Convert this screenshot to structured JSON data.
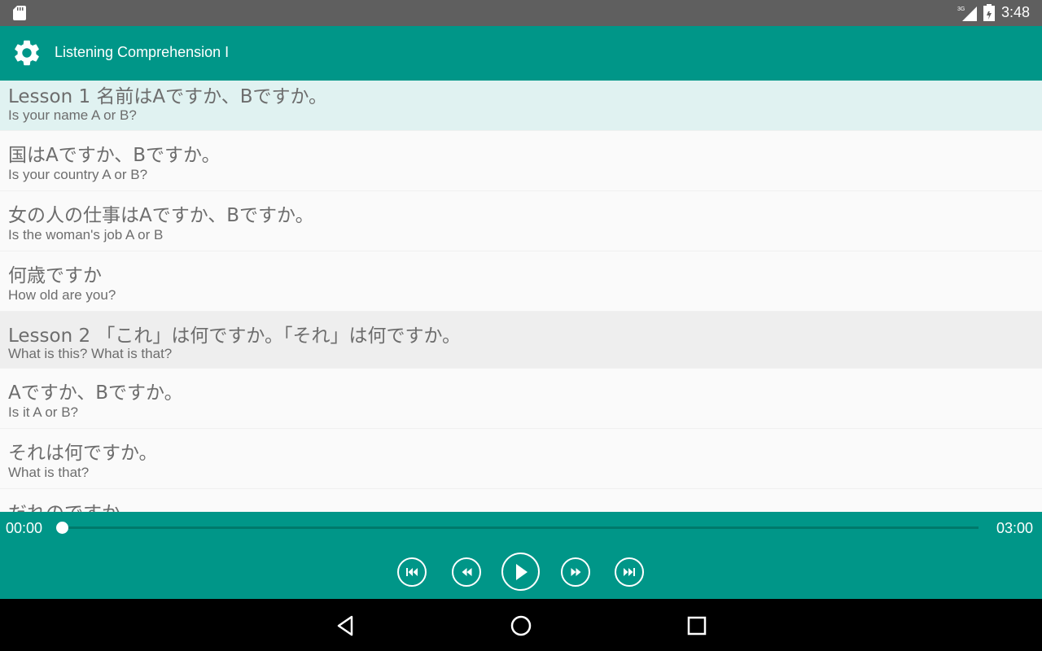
{
  "status_bar": {
    "time": "3:48",
    "network": "3G"
  },
  "app_bar": {
    "title": "Listening Comprehension I",
    "settings_icon": "gear-icon"
  },
  "lessons": [
    {
      "jp": "Lesson 1 名前はAですか、Bですか。",
      "en": "Is your name A or B?",
      "kind": "header-selected"
    },
    {
      "jp": "国はAですか、Bですか。",
      "en": "Is your country A or B?",
      "kind": "item"
    },
    {
      "jp": "女の人の仕事はAですか、Bですか。",
      "en": "Is the woman's job A or B",
      "kind": "item"
    },
    {
      "jp": "何歳ですか",
      "en": "How old are you?",
      "kind": "item"
    },
    {
      "jp": "Lesson 2 「これ」は何ですか。「それ」は何ですか。",
      "en": "What is this? What is that?",
      "kind": "header"
    },
    {
      "jp": "Aですか、Bですか。",
      "en": "Is it A or B?",
      "kind": "item"
    },
    {
      "jp": "それは何ですか。",
      "en": "What is that?",
      "kind": "item"
    },
    {
      "jp": "だれのですか。",
      "en": "",
      "kind": "item"
    }
  ],
  "player": {
    "current_time": "00:00",
    "total_time": "03:00",
    "progress": 0,
    "controls": [
      "skip-previous-icon",
      "rewind-icon",
      "play-icon",
      "fast-forward-icon",
      "skip-next-icon"
    ]
  },
  "colors": {
    "primary": "#009688",
    "selected_row": "#e0f2f1",
    "header_row": "#eeeeee",
    "status_bar": "#5f5f5f"
  }
}
